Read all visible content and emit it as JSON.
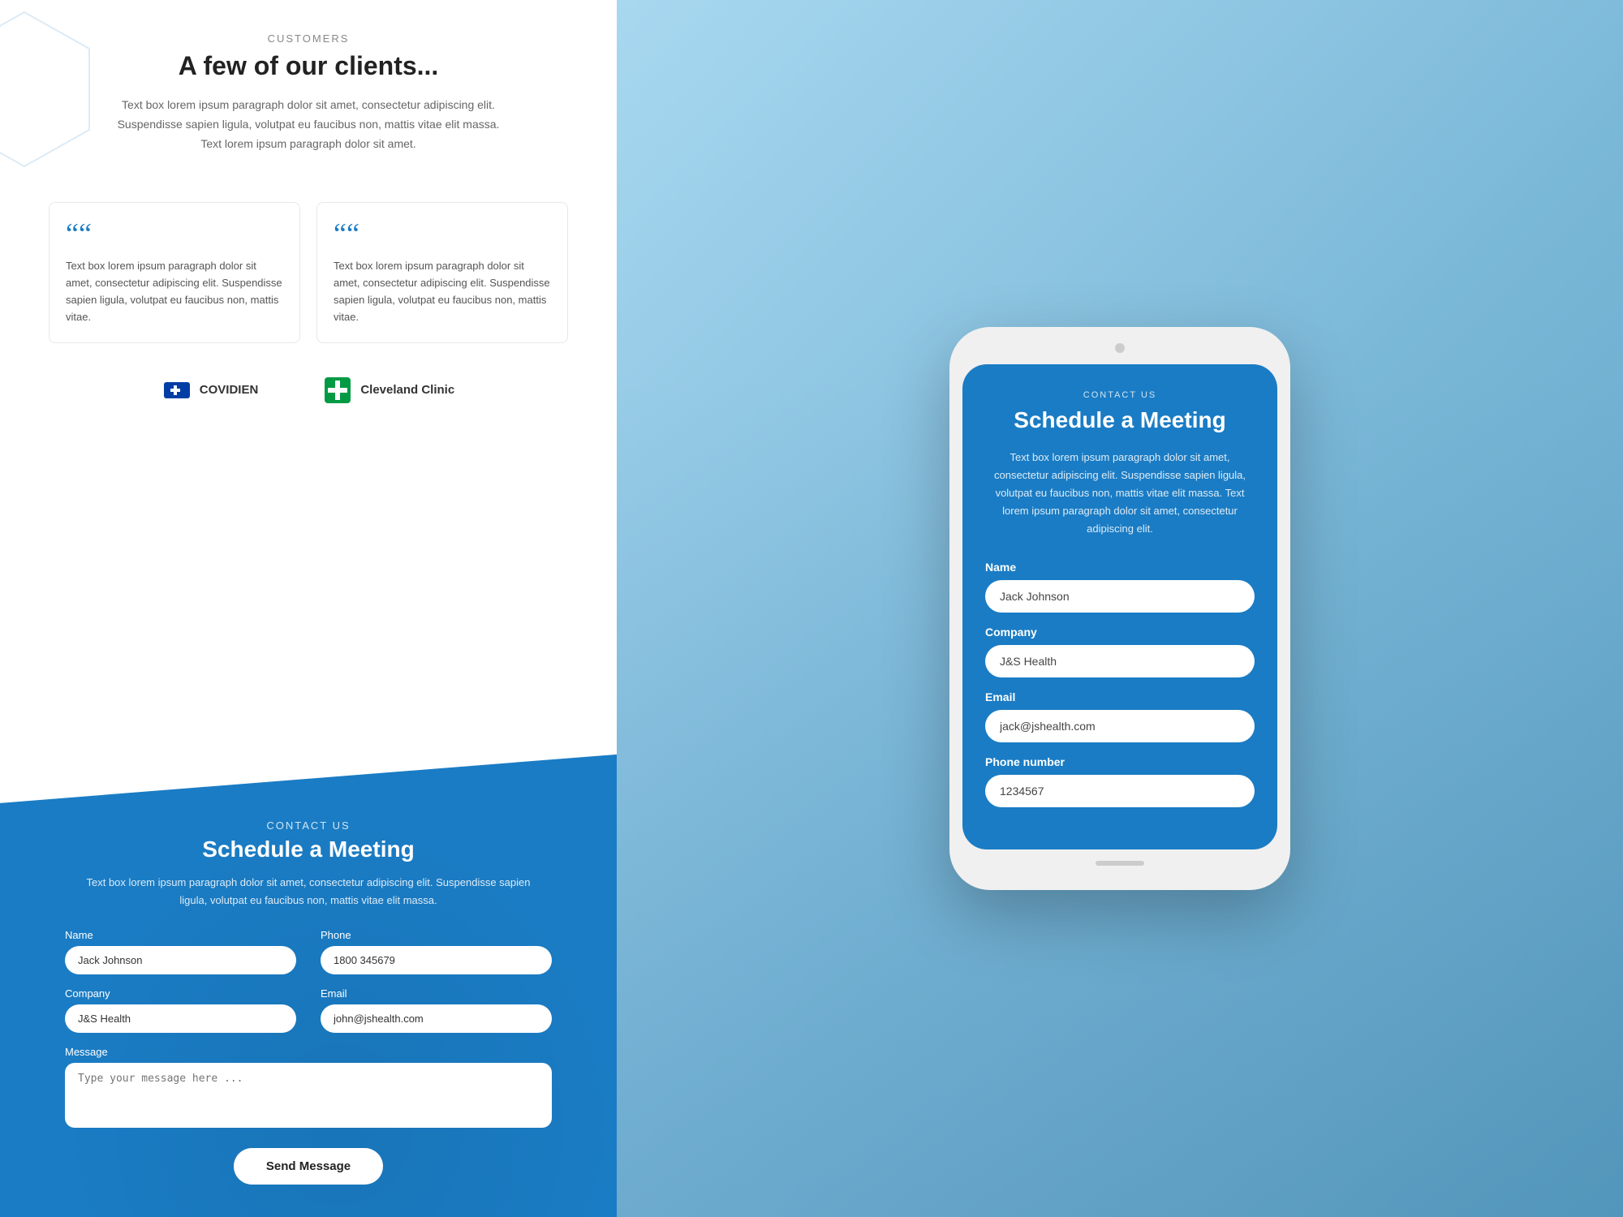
{
  "left": {
    "customers_label": "CUSTOMERS",
    "customers_title": "A few of our clients...",
    "customers_desc": "Text box lorem ipsum paragraph dolor sit amet, consectetur adipiscing elit. Suspendisse sapien ligula, volutpat eu faucibus non, mattis vitae elit massa. Text lorem ipsum paragraph dolor sit amet.",
    "testimonials": [
      {
        "quote": "““",
        "text": "Text box lorem ipsum paragraph dolor sit amet, consectetur adipiscing elit. Suspendisse sapien ligula, volutpat eu faucibus non, mattis vitae."
      },
      {
        "quote": "““",
        "text": "Text box lorem ipsum paragraph dolor sit amet, consectetur adipiscing elit. Suspendisse sapien ligula, volutpat eu faucibus non, mattis vitae."
      }
    ],
    "clients": [
      {
        "name": "COVIDIEN"
      },
      {
        "name": "Cleveland Clinic"
      }
    ],
    "contact_label": "CONTACT US",
    "contact_title": "Schedule a Meeting",
    "contact_desc": "Text box lorem ipsum paragraph dolor sit amet, consectetur adipiscing elit. Suspendisse sapien ligula, volutpat eu faucibus non, mattis vitae elit massa.",
    "form": {
      "name_label": "Name",
      "name_value": "Jack Johnson",
      "phone_label": "Phone",
      "phone_value": "1800 345679",
      "company_label": "Company",
      "company_value": "J&S Health",
      "email_label": "Email",
      "email_value": "john@jshealth.com",
      "message_label": "Message",
      "message_placeholder": "Type your message here ...",
      "send_label": "Send Message"
    }
  },
  "right": {
    "phone": {
      "contact_label": "CONTACT US",
      "title": "Schedule a Meeting",
      "desc": "Text box lorem ipsum paragraph dolor sit amet, consectetur adipiscing elit. Suspendisse sapien ligula, volutpat eu faucibus non, mattis vitae elit massa. Text lorem ipsum paragraph dolor sit amet, consectetur adipiscing elit.",
      "form": {
        "name_label": "Name",
        "name_value": "Jack Johnson",
        "company_label": "Company",
        "company_value": "J&S Health",
        "email_label": "Email",
        "email_value": "jack@jshealth.com",
        "phone_label": "Phone number",
        "phone_value": "1234567"
      }
    }
  }
}
